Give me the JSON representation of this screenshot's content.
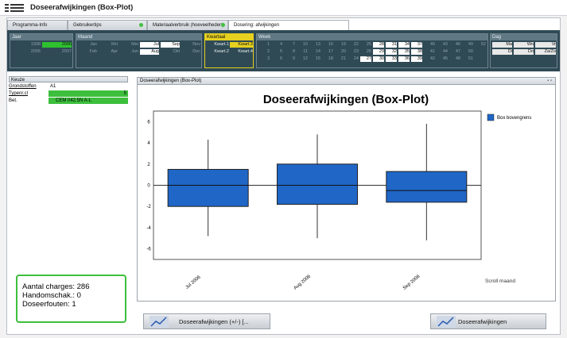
{
  "window": {
    "title": "Doseerafwijkingen (Box-Plot)"
  },
  "tabs": [
    {
      "label": "Programma-Info"
    },
    {
      "label": "Gebruikertips"
    },
    {
      "label": "Materiaalverbruik (hoeveelheden)"
    },
    {
      "label": "Dosering: afwijkingen"
    }
  ],
  "filters": {
    "jaar": {
      "label": "Jaar",
      "values": [
        "1998",
        "2006",
        "2005",
        "2007"
      ]
    },
    "maand": {
      "label": "Maand",
      "values": [
        "Jan",
        "Mrt",
        "Mei",
        "Jul",
        "Sep",
        "Nov",
        "Feb",
        "Apr",
        "Jun",
        "Aug",
        "Okt",
        "Dec"
      ]
    },
    "kwartaal": {
      "label": "Kwartaal",
      "values": [
        "Kwart.1",
        "Kwart.3",
        "Kwart.2",
        "Kwart.4"
      ]
    },
    "week": {
      "label": "Week",
      "row1": [
        "1",
        "4",
        "7",
        "10",
        "13",
        "16",
        "19",
        "22",
        "25",
        "28",
        "31",
        "34",
        "37",
        "40",
        "43",
        "46",
        "49",
        "52"
      ],
      "row2": [
        "2",
        "5",
        "8",
        "11",
        "14",
        "17",
        "20",
        "23",
        "26",
        "29",
        "32",
        "35",
        "38",
        "41",
        "44",
        "47",
        "50"
      ],
      "row3": [
        "3",
        "6",
        "9",
        "12",
        "15",
        "18",
        "21",
        "24",
        "27",
        "30",
        "33",
        "36",
        "39",
        "42",
        "45",
        "48",
        "51"
      ]
    },
    "dag": {
      "label": "Dag",
      "values": [
        "Ma",
        "Wo",
        "Vr",
        "Di",
        "Do",
        "Za/Zo"
      ]
    }
  },
  "keuze": {
    "label": "Keuze",
    "rows": [
      {
        "label": "Grondstoffen",
        "value": "A1"
      },
      {
        "label": "Typenr.cl",
        "value": "5"
      },
      {
        "label": "Bet.",
        "value": "CEM I/42.5N A-L"
      }
    ]
  },
  "stats": {
    "charges": "Aantal charges: 286",
    "handomschak": "Handomschak.: 0",
    "fouten": "Doseerfouten: 1"
  },
  "panel": {
    "header": "Doseerafwijkingen (Box-Plot)",
    "controls": "- ▫",
    "scroll": "Scroll maand"
  },
  "buttons": {
    "left": "Doseerafwijkingen (+/-) [...",
    "right": "Doseerafwijkingen"
  },
  "colors": {
    "box": "#1f66c7",
    "accent_green": "#3dbf3d",
    "dark_bar": "#2f4a55"
  },
  "chart_data": {
    "type": "box",
    "title": "Doseerafwijkingen (Box-Plot)",
    "categories": [
      "Jul 2006",
      "Aug 2006",
      "Sep 2006"
    ],
    "boxes": [
      {
        "min": -4.8,
        "q1": -2.0,
        "median": 0.0,
        "q3": 1.5,
        "max": 4.3
      },
      {
        "min": -5.0,
        "q1": -1.8,
        "median": 0.0,
        "q3": 2.0,
        "max": 4.8
      },
      {
        "min": -5.2,
        "q1": -1.6,
        "median": -0.5,
        "q3": 1.3,
        "max": 5.8
      }
    ],
    "yticks": [
      6,
      4,
      2,
      0,
      -2,
      -4,
      -6
    ],
    "ylim": [
      -7,
      7
    ],
    "legend": "Box bovengrens",
    "legend_position": "right",
    "grid": false
  }
}
